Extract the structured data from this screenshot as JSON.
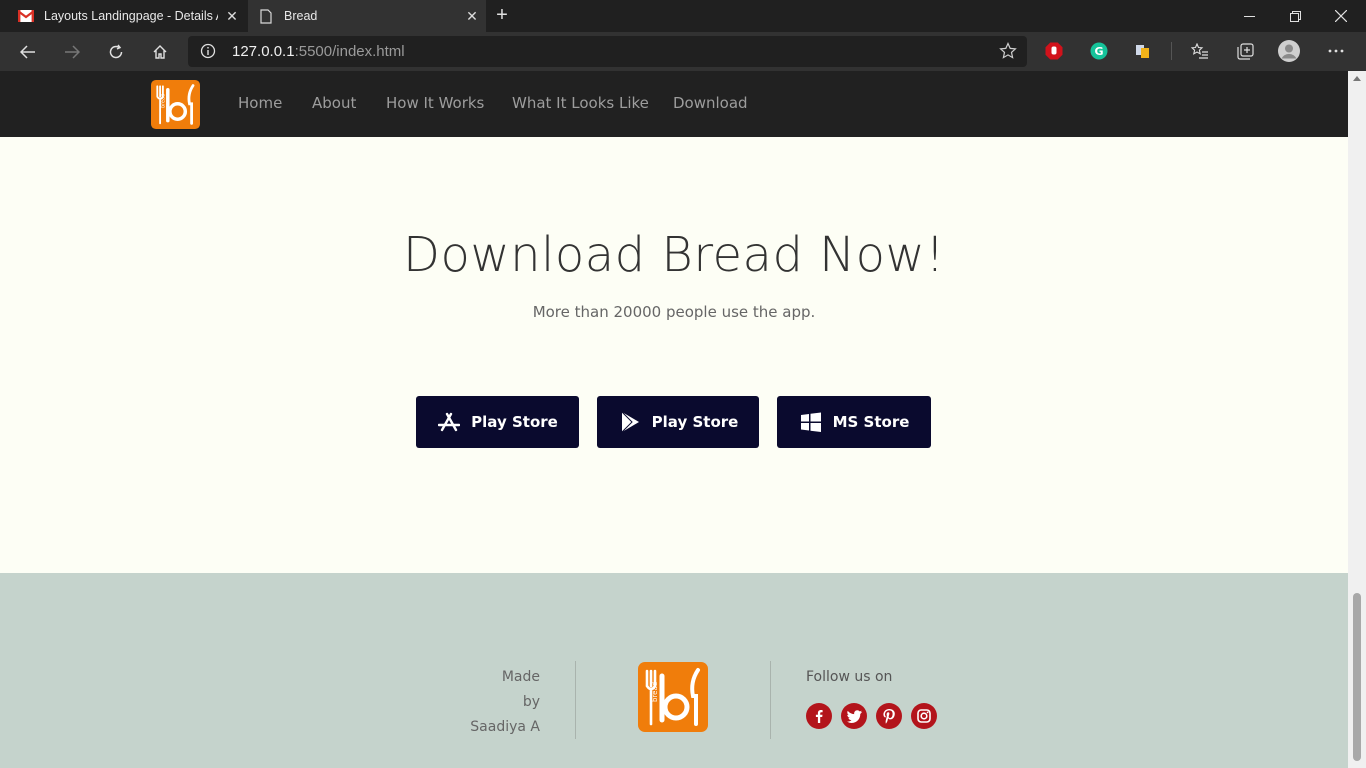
{
  "browser": {
    "tabs": [
      {
        "title": "Layouts Landingpage - Details A",
        "icon": "gmail-icon"
      },
      {
        "title": "Bread",
        "icon": "page-icon"
      }
    ],
    "address": {
      "host": "127.0.0.1",
      "path": ":5500/index.html"
    }
  },
  "nav": {
    "links": [
      "Home",
      "About",
      "How It Works",
      "What It Looks Like",
      "Download"
    ]
  },
  "logo": {
    "text": "bread",
    "color": "#f07d0b"
  },
  "download": {
    "title": "Download Bread Now!",
    "subtitle": "More than 20000 people use the app.",
    "buttons": [
      {
        "label": "Play Store",
        "icon": "app-store-icon"
      },
      {
        "label": "Play Store",
        "icon": "play-store-icon"
      },
      {
        "label": "MS Store",
        "icon": "windows-icon"
      }
    ]
  },
  "footer": {
    "made_lines": [
      "Made",
      "by",
      "Saadiya A"
    ],
    "follow": "Follow us on",
    "social": [
      "facebook-icon",
      "twitter-icon",
      "pinterest-icon",
      "instagram-icon"
    ],
    "social_color": "#b3141b"
  },
  "colors": {
    "nav_bg": "#212121",
    "page_bg": "#fdfef5",
    "footer_bg": "#c5d3cc",
    "button_bg": "#0a0a2e"
  }
}
